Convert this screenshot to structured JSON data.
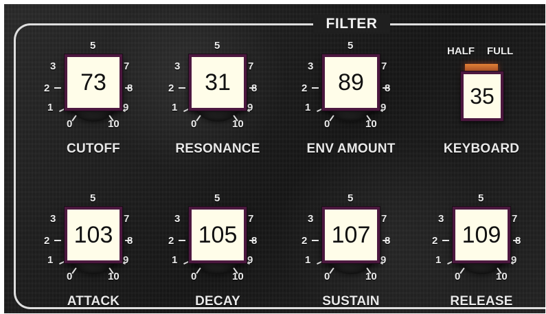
{
  "panel": {
    "title": "FILTER"
  },
  "dial": {
    "labels": [
      "0",
      "1",
      "2",
      "3",
      "5",
      "7",
      "8",
      "9",
      "10"
    ]
  },
  "controls": [
    {
      "id": "cutoff",
      "label": "CUTOFF",
      "value": "73"
    },
    {
      "id": "resonance",
      "label": "RESONANCE",
      "value": "31"
    },
    {
      "id": "env_amount",
      "label": "ENV AMOUNT",
      "value": "89"
    },
    {
      "id": "attack",
      "label": "ATTACK",
      "value": "103"
    },
    {
      "id": "decay",
      "label": "DECAY",
      "value": "105"
    },
    {
      "id": "sustain",
      "label": "SUSTAIN",
      "value": "107"
    },
    {
      "id": "release",
      "label": "RELEASE",
      "value": "109"
    }
  ],
  "keyboard": {
    "half_label": "HALF",
    "full_label": "FULL",
    "value": "35",
    "label": "KEYBOARD"
  }
}
